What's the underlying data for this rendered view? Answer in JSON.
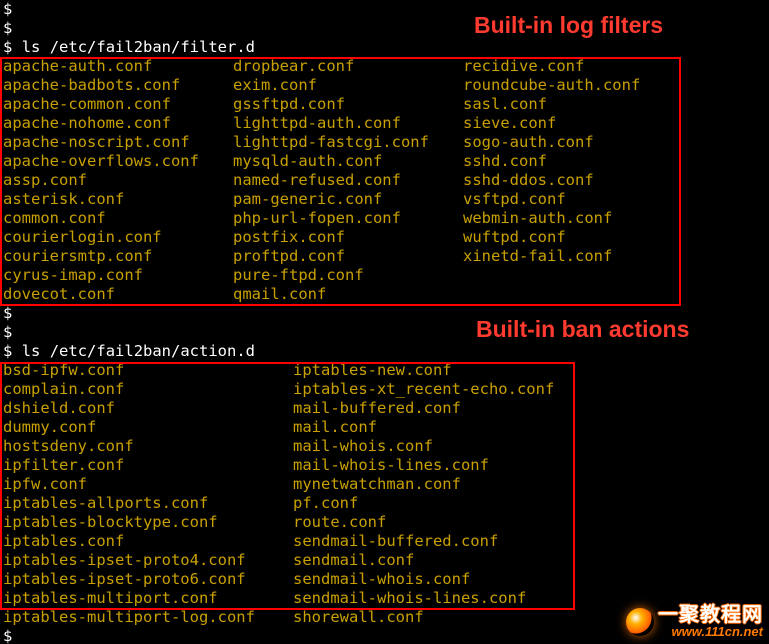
{
  "prompt_symbol": "$",
  "annotations": {
    "label1": "Built-in log filters",
    "label2": "Built-in ban actions"
  },
  "cmd1": {
    "command": "ls",
    "dir_tilde": " ",
    "path": "/etc/fail2ban/filter.d"
  },
  "cmd2": {
    "command": "ls",
    "dir_tilde": " ",
    "path": "/etc/fail2ban/action.d"
  },
  "filters": {
    "col1": [
      "apache-auth.conf",
      "apache-badbots.conf",
      "apache-common.conf",
      "apache-nohome.conf",
      "apache-noscript.conf",
      "apache-overflows.conf",
      "assp.conf",
      "asterisk.conf",
      "common.conf",
      "courierlogin.conf",
      "couriersmtp.conf",
      "cyrus-imap.conf",
      "dovecot.conf"
    ],
    "col2": [
      "dropbear.conf",
      "exim.conf",
      "gssftpd.conf",
      "lighttpd-auth.conf",
      "lighttpd-fastcgi.conf",
      "mysqld-auth.conf",
      "named-refused.conf",
      "pam-generic.conf",
      "php-url-fopen.conf",
      "postfix.conf",
      "proftpd.conf",
      "pure-ftpd.conf",
      "qmail.conf"
    ],
    "col3": [
      "recidive.conf",
      "roundcube-auth.conf",
      "sasl.conf",
      "sieve.conf",
      "sogo-auth.conf",
      "sshd.conf",
      "sshd-ddos.conf",
      "vsftpd.conf",
      "webmin-auth.conf",
      "wuftpd.conf",
      "xinetd-fail.conf"
    ]
  },
  "actions": {
    "col1": [
      "bsd-ipfw.conf",
      "complain.conf",
      "dshield.conf",
      "dummy.conf",
      "hostsdeny.conf",
      "ipfilter.conf",
      "ipfw.conf",
      "iptables-allports.conf",
      "iptables-blocktype.conf",
      "iptables.conf",
      "iptables-ipset-proto4.conf",
      "iptables-ipset-proto6.conf",
      "iptables-multiport.conf",
      "iptables-multiport-log.conf"
    ],
    "col2": [
      "iptables-new.conf",
      "iptables-xt_recent-echo.conf",
      "mail-buffered.conf",
      "mail.conf",
      "mail-whois.conf",
      "mail-whois-lines.conf",
      "mynetwatchman.conf",
      "pf.conf",
      "route.conf",
      "sendmail-buffered.conf",
      "sendmail.conf",
      "sendmail-whois.conf",
      "sendmail-whois-lines.conf",
      "shorewall.conf"
    ]
  },
  "watermark": {
    "line1": "一聚教程网",
    "line2": "www.111cn.net"
  }
}
